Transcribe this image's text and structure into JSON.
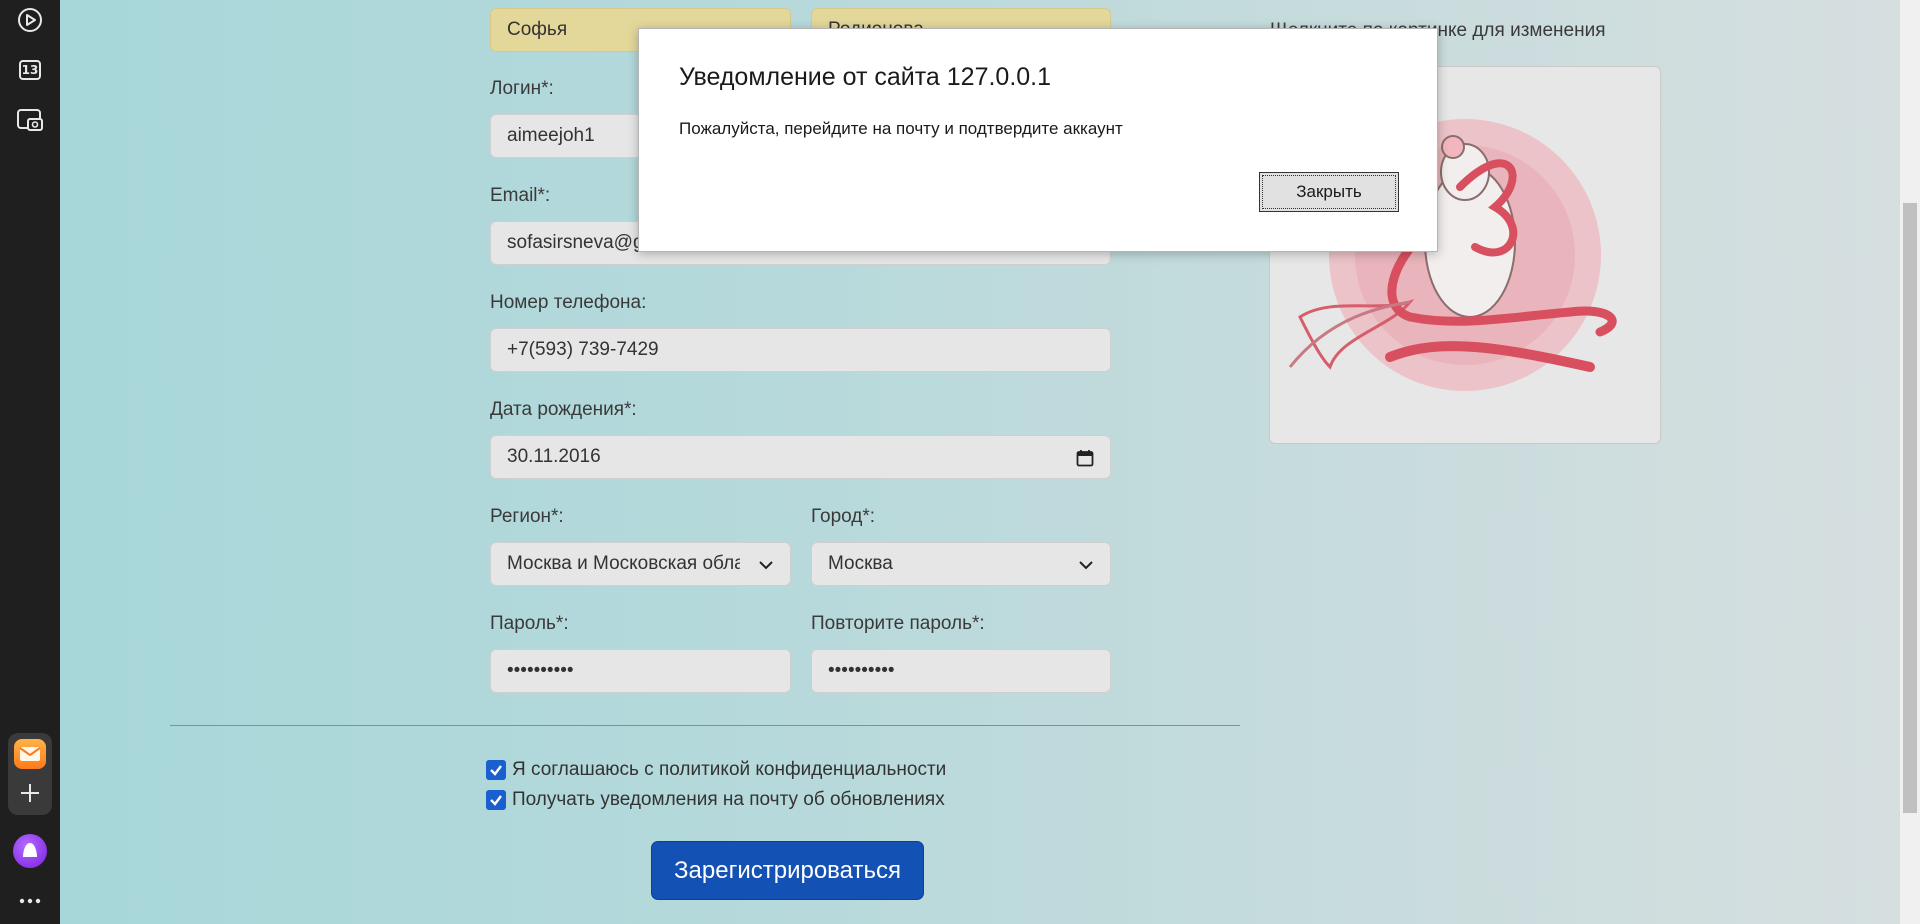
{
  "form": {
    "first_name_value": "Софья",
    "second_name_value": "Родионова",
    "login_label": "Логин*:",
    "login_value": "aimeejoh1",
    "email_label": "Email*:",
    "email_value": "sofasirsneva@gmail.com",
    "phone_label": "Номер телефона:",
    "phone_value": "+7(593) 739-7429",
    "birth_label": "Дата рождения*:",
    "birth_value": "30.11.2016",
    "region_label": "Регион*:",
    "region_value": "Москва и Московская область",
    "city_label": "Город*:",
    "city_value": "Москва",
    "password_label": "Пароль*:",
    "password_value": "••••••••••",
    "password_repeat_label": "Повторите пароль*:",
    "password_repeat_value": "••••••••••",
    "privacy_checkbox_label": "Я соглашаюсь с политикой конфиденциальности",
    "privacy_checked": true,
    "updates_checkbox_label": "Получать уведомления на почту об обновлениях",
    "updates_checked": true,
    "register_button": "Зарегистрироваться",
    "avatar_hint": "Щелкните по картинке для изменения"
  },
  "dialog": {
    "title": "Уведомление от сайта 127.0.0.1",
    "message": "Пожалуйста, перейдите на почту и подтвердите аккаунт",
    "close_button": "Закрыть"
  },
  "browser_sidebar": {
    "calendar_day": "13",
    "icons": [
      "play-icon",
      "calendar-icon",
      "screenshot-icon",
      "mail-icon",
      "plus-icon",
      "alice-icon",
      "more-icon"
    ]
  },
  "colors": {
    "accent_button": "#1451b4",
    "name_field_bg": "#e3d79a",
    "checkbox": "#1a5fd0"
  }
}
